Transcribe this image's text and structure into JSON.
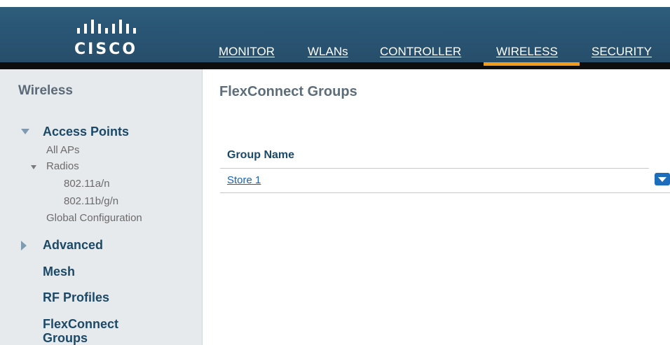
{
  "brand": {
    "wordmark": "CISCO"
  },
  "nav": {
    "items": [
      {
        "label": "MONITOR"
      },
      {
        "label": "WLANs"
      },
      {
        "label": "CONTROLLER"
      },
      {
        "label": "WIRELESS",
        "active": true
      },
      {
        "label": "SECURITY"
      }
    ]
  },
  "sidebar": {
    "title": "Wireless",
    "access_points": {
      "label": "Access Points",
      "all_aps": "All APs",
      "radios": "Radios",
      "radio_a": "802.11a/n",
      "radio_bg": "802.11b/g/n",
      "global_config": "Global Configuration"
    },
    "advanced": "Advanced",
    "mesh": "Mesh",
    "rf_profiles": "RF Profiles",
    "flexconnect_groups": "FlexConnect Groups"
  },
  "main": {
    "title": "FlexConnect Groups",
    "table": {
      "column_header": "Group Name",
      "rows": [
        {
          "group_name": "Store 1"
        }
      ]
    }
  },
  "colors": {
    "header_bg": "#2a5574",
    "active_tab_underline": "#f39c1a",
    "sidebar_bg": "#e7eaec",
    "sidebar_heading": "#1b4968",
    "link": "#1a5fb4"
  },
  "icons": {
    "expand_access_points": "triangle-down-icon",
    "expand_radios": "triangle-down-icon",
    "expand_advanced": "triangle-right-icon",
    "row_menu": "dropdown-arrow-icon"
  }
}
